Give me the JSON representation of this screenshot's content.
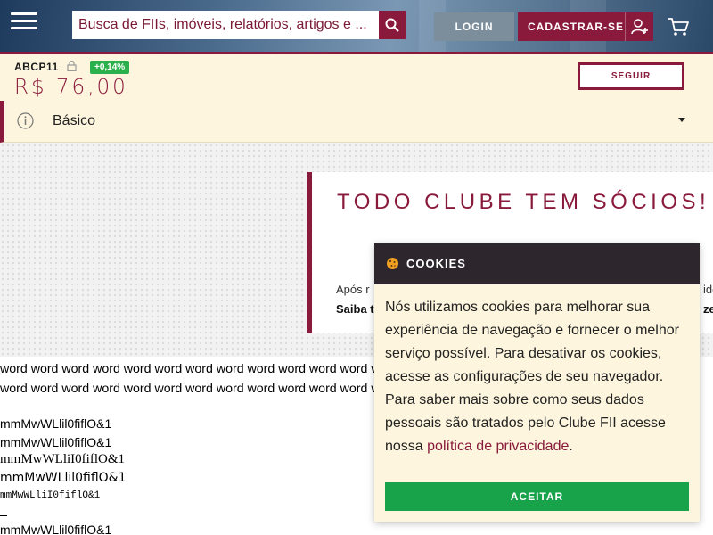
{
  "header": {
    "search": {
      "placeholder": "Busca de FIIs, imóveis, relatórios, artigos e ..."
    },
    "login_label": "LOGIN",
    "signup_label": "CADASTRAR-SE",
    "icons": [
      "menu-icon",
      "search-icon",
      "user-plus-icon",
      "cart-icon"
    ]
  },
  "ticker": {
    "symbol": "ABCP11",
    "change": "+0,14%",
    "price": "R$ 76,00",
    "follow_label": "SEGUIR",
    "icons": [
      "lock-icon"
    ]
  },
  "section": {
    "label": "Básico",
    "icons": [
      "info-icon",
      "caret-down-icon"
    ]
  },
  "promo": {
    "title": "TODO CLUBE TEM SÓCIOS! V",
    "text_left": "Após r",
    "link_left": "Saiba t",
    "text_right": "ido",
    "link_right": "ze"
  },
  "test_text": {
    "words_line1": "word word word word word word word word word word word word w",
    "words_line2": "word word word word word word word word word word word word w",
    "glyphs1": "mmMwWLlil0fiflO&1",
    "glyphs2": "mmMwWLlil0fiflO&1",
    "glyphs3": "mmMwWLliI0fiflO&1",
    "glyphs4": "mmMwWLlil0fiflO&1",
    "glyphs5": "mmMwWLliI0fiflO&1",
    "glyphs6": "mmMwWLlil0fiflO&1"
  },
  "cookie": {
    "title": "COOKIES",
    "body": "Nós utilizamos cookies para melhorar sua experiência de navegação e fornecer o melhor serviço possível. Para desativar os cookies, acesse as configurações de seu navegador. Para saber mais sobre como seus dados pessoais são tratados pelo Clube FII acesse nossa",
    "link": "política de privacidade",
    "suffix": ".",
    "accept_label": "ACEITAR",
    "icons": [
      "cookie-icon"
    ]
  },
  "colors": {
    "brand": "#8a1a3c",
    "cream": "#fdf5dd",
    "positive": "#2bb14b",
    "accept": "#18a34a",
    "dark": "#2d262d"
  }
}
